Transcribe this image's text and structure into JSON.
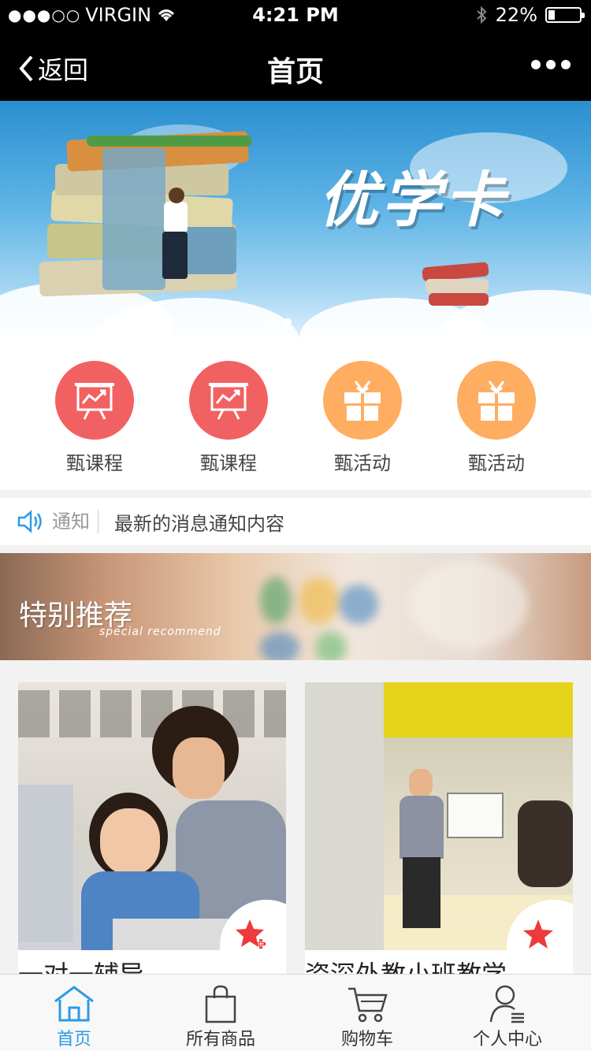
{
  "status_bar": {
    "carrier": "VIRGIN",
    "time": "4:21 PM",
    "battery": "22%",
    "battery_level": 0.22
  },
  "nav": {
    "back_label": "返回",
    "title": "首页"
  },
  "banner": {
    "title": "优学卡",
    "active_slide": 2,
    "slide_count": 2
  },
  "quick_links": [
    {
      "label": "甄课程",
      "icon": "presentation-board-icon",
      "color": "#f26161"
    },
    {
      "label": "甄课程",
      "icon": "presentation-board-icon",
      "color": "#f26161"
    },
    {
      "label": "甄活动",
      "icon": "gift-icon",
      "color": "#ffad61"
    },
    {
      "label": "甄活动",
      "icon": "gift-icon",
      "color": "#ffad61"
    }
  ],
  "notice": {
    "tag": "通知",
    "message": "最新的消息通知内容"
  },
  "recommend": {
    "title": "特别推荐",
    "subtitle": "special recommend"
  },
  "products": [
    {
      "title": "一对一辅导",
      "fav_icon": "star-plus-icon"
    },
    {
      "title": "资深外教小班教学",
      "fav_icon": "star-icon"
    }
  ],
  "tabs": [
    {
      "label": "首页",
      "icon": "home-icon",
      "active": true
    },
    {
      "label": "所有商品",
      "icon": "shopping-bag-icon",
      "active": false
    },
    {
      "label": "购物车",
      "icon": "cart-icon",
      "active": false
    },
    {
      "label": "个人中心",
      "icon": "user-icon",
      "active": false
    }
  ],
  "colors": {
    "accent": "#2b9be5",
    "course": "#f26161",
    "activity": "#ffad61",
    "star": "#ee3a3a"
  }
}
